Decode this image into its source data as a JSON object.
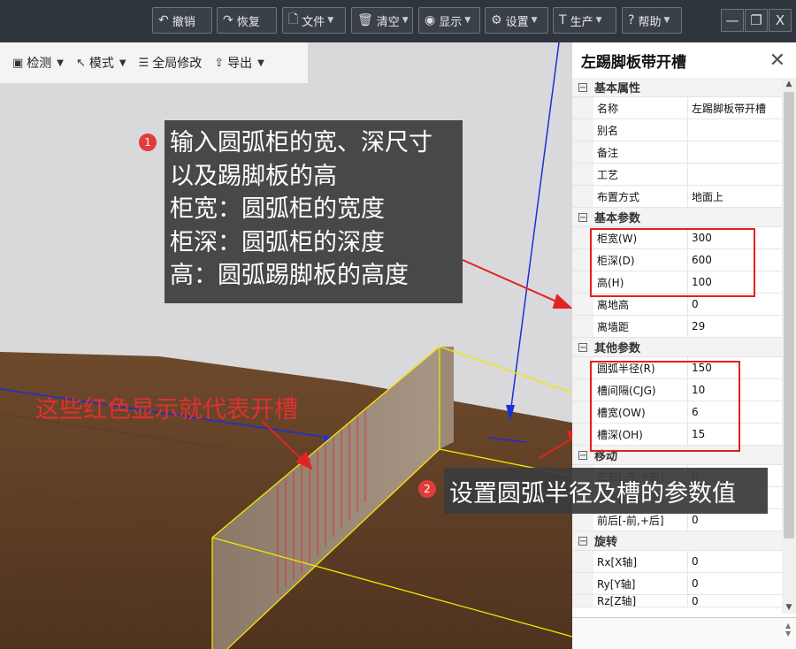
{
  "toolbar": {
    "undo": "撤销",
    "redo": "恢复",
    "file": "文件",
    "clear": "清空",
    "display": "显示",
    "settings": "设置",
    "production": "生产",
    "help": "帮助"
  },
  "window": {
    "minimize": "—",
    "restore": "❐",
    "close": "X"
  },
  "subtoolbar": {
    "detect": "检测",
    "mode": "模式",
    "global_edit": "全局修改",
    "export": "导出"
  },
  "annotations": {
    "callout1_badge": "1",
    "callout1_lines": [
      "输入圆弧柜的宽、深尺寸",
      "以及踢脚板的高",
      "柜宽：圆弧柜的宽度",
      "柜深：圆弧柜的深度",
      "高：圆弧踢脚板的高度"
    ],
    "callout2_badge": "2",
    "callout2_text": "设置圆弧半径及槽的参数值",
    "red_note": "这些红色显示就代表开槽"
  },
  "panel": {
    "title": "左踢脚板带开槽",
    "sections": [
      {
        "title": "基本属性",
        "rows": [
          {
            "key": "名称",
            "value": "左踢脚板带开槽"
          },
          {
            "key": "别名",
            "value": ""
          },
          {
            "key": "备注",
            "value": ""
          },
          {
            "key": "工艺",
            "value": ""
          },
          {
            "key": "布置方式",
            "value": "地面上"
          }
        ]
      },
      {
        "title": "基本参数",
        "rows": [
          {
            "key": "柜宽(W)",
            "value": "300"
          },
          {
            "key": "柜深(D)",
            "value": "600"
          },
          {
            "key": "高(H)",
            "value": "100"
          },
          {
            "key": "离地高",
            "value": "0"
          },
          {
            "key": "离墙距",
            "value": "29"
          }
        ]
      },
      {
        "title": "其他参数",
        "rows": [
          {
            "key": "圆弧半径(R)",
            "value": "150"
          },
          {
            "key": "槽间隔(CJG)",
            "value": "10"
          },
          {
            "key": "槽宽(OW)",
            "value": "6"
          },
          {
            "key": "槽深(OH)",
            "value": "15"
          }
        ]
      },
      {
        "title": "移动",
        "rows": [
          {
            "key": "左右[-左,+右]",
            "value": "0"
          },
          {
            "key": "上下[-下,+上]",
            "value": "0"
          },
          {
            "key": "前后[-前,+后]",
            "value": "0"
          }
        ]
      },
      {
        "title": "旋转",
        "rows": [
          {
            "key": "Rx[X轴]",
            "value": "0"
          },
          {
            "key": "Ry[Y轴]",
            "value": "0"
          },
          {
            "key": "Rz[Z轴]",
            "value": "0"
          }
        ]
      }
    ]
  }
}
